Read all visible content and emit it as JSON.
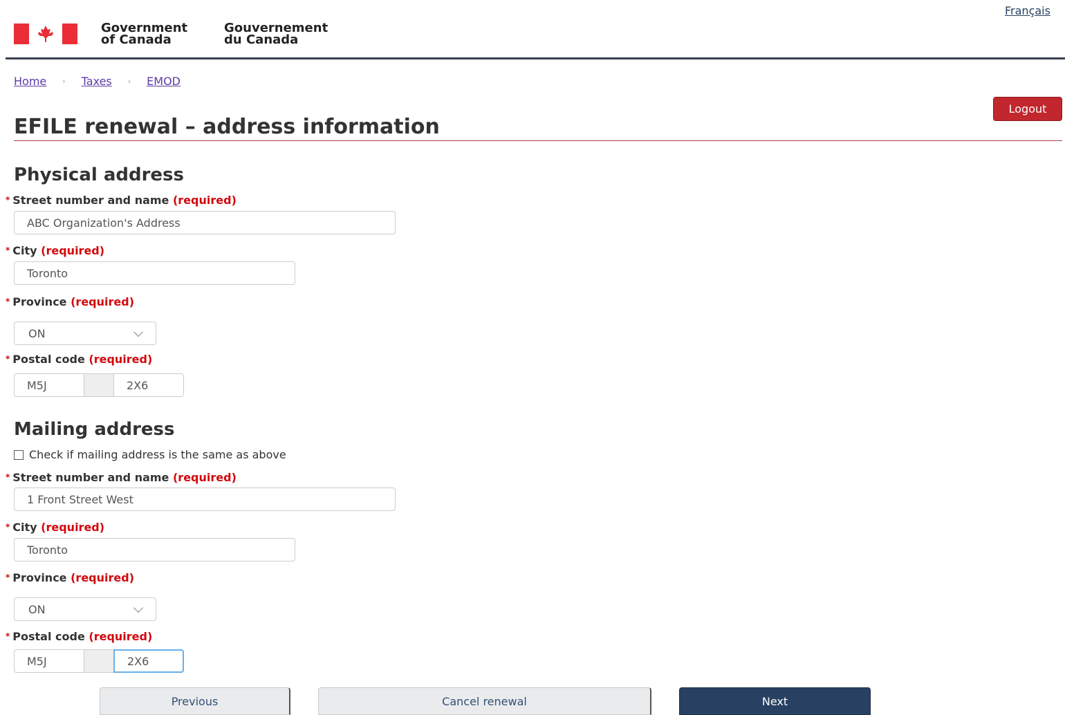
{
  "header": {
    "gov_en_line1": "Government",
    "gov_en_line2": "of Canada",
    "gov_fr_line1": "Gouvernement",
    "gov_fr_line2": "du Canada",
    "language_link": "Français"
  },
  "breadcrumb": [
    "Home",
    "Taxes",
    "EMOD"
  ],
  "breadcrumb_sep": "›",
  "logout_label": "Logout",
  "page_title": "EFILE renewal – address information",
  "required_text": "(required)",
  "physical": {
    "title": "Physical address",
    "street_label": "Street number and name",
    "street_value": "ABC Organization's Address",
    "city_label": "City",
    "city_value": "Toronto",
    "province_label": "Province",
    "province_value": "ON",
    "postal_label": "Postal code",
    "postal_part1": "M5J",
    "postal_part2": "2X6"
  },
  "mailing": {
    "title": "Mailing address",
    "same_as_label": "Check if mailing address is the same as above",
    "street_label": "Street number and name",
    "street_value": "1 Front Street West",
    "city_label": "City",
    "city_value": "Toronto",
    "province_label": "Province",
    "province_value": "ON",
    "postal_label": "Postal code",
    "postal_part1": "M5J",
    "postal_part2": "2X6"
  },
  "buttons": {
    "previous": "Previous",
    "cancel": "Cancel renewal",
    "next": "Next"
  },
  "colors": {
    "flag_red": "#eb2d37",
    "primary": "#284162",
    "danger": "#c1272d",
    "required": "#d3080c"
  }
}
